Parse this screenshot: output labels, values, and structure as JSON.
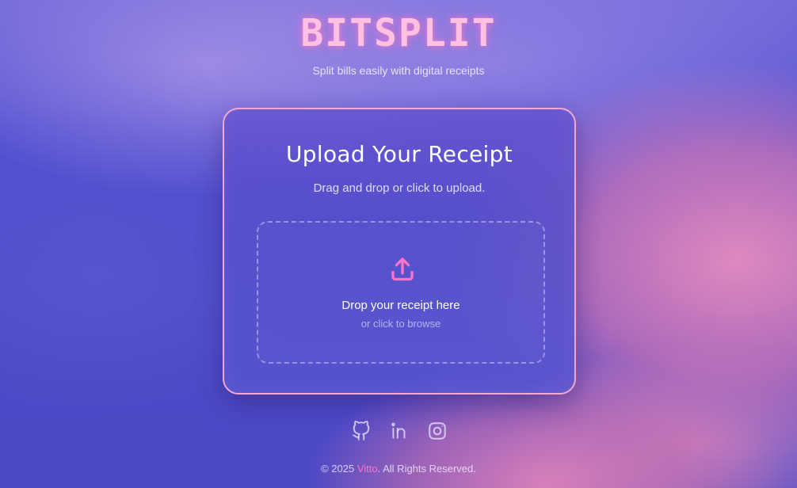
{
  "header": {
    "title": "BITSPLIT",
    "tagline": "Split bills easily with digital receipts"
  },
  "upload_card": {
    "title": "Upload Your Receipt",
    "subtitle": "Drag and drop or click to upload.",
    "dropzone": {
      "title": "Drop your receipt here",
      "subtitle": "or click to browse"
    }
  },
  "socials": [
    {
      "icon": "github-icon"
    },
    {
      "icon": "linkedin-icon"
    },
    {
      "icon": "instagram-icon"
    }
  ],
  "footer": {
    "prefix": "© 2025 ",
    "brand": "Vitto",
    "suffix": ". All Rights Reserved."
  },
  "colors": {
    "accent_pink": "#ff73cb",
    "title_pink": "#ffc0e2",
    "card_border": "#f3a9d3",
    "background_primary": "#4c49c9"
  }
}
